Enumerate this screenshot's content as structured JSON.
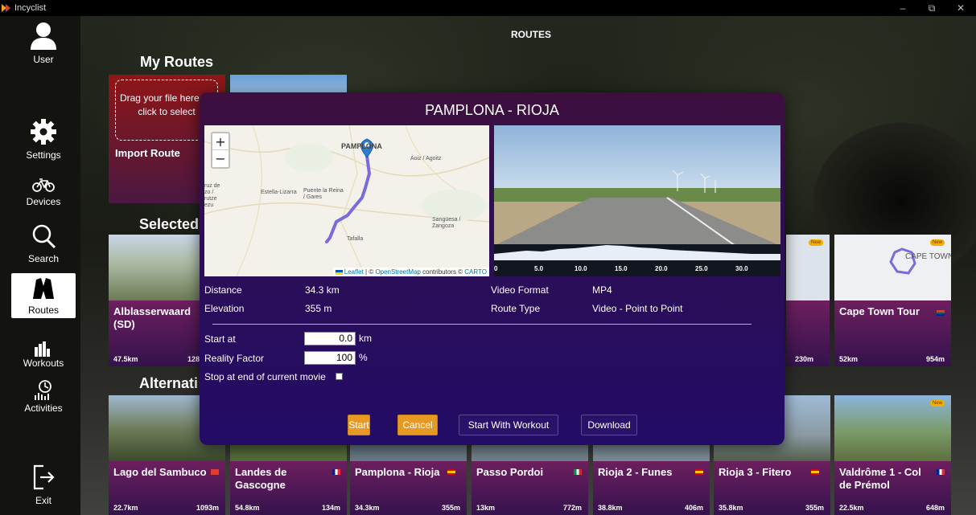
{
  "window": {
    "title": "Incyclist",
    "minimize": "–",
    "maximize": "⧉",
    "close": "✕"
  },
  "sidebar": [
    {
      "label": "User",
      "icon": "user-icon"
    },
    {
      "label": "Settings",
      "icon": "gear-icon"
    },
    {
      "label": "Devices",
      "icon": "bicycle-icon"
    },
    {
      "label": "Search",
      "icon": "search-icon"
    },
    {
      "label": "Routes",
      "icon": "routes-icon"
    },
    {
      "label": "Workouts",
      "icon": "workouts-icon"
    },
    {
      "label": "Activities",
      "icon": "activities-icon"
    },
    {
      "label": "Exit",
      "icon": "exit-icon"
    }
  ],
  "header": {
    "title": "ROUTES"
  },
  "sections": {
    "my_routes": "My Routes",
    "selected": "Selected",
    "alternatives": "Alternati"
  },
  "import": {
    "drop_text": "Drag your file here, or click to select",
    "label": "Import Route"
  },
  "selected_cards": [
    {
      "title": "Alblasserwaard (SD)",
      "distance": "47.5km",
      "elevation": "128"
    },
    {
      "title": "Cape Town Tour",
      "distance": "52km",
      "elevation": "954m",
      "badge": "New",
      "map_label": "CAPE TOWN"
    }
  ],
  "selected_partial": {
    "elevation": "230m",
    "badge": "New"
  },
  "alt_cards": [
    {
      "title": "Lago del Sambuco",
      "distance": "22.7km",
      "elevation": "1093m",
      "flag": "ch"
    },
    {
      "title": "Landes de Gascogne",
      "distance": "54.8km",
      "elevation": "134m",
      "flag": "fr"
    },
    {
      "title": "Pamplona - Rioja",
      "distance": "34.3km",
      "elevation": "355m",
      "flag": "es"
    },
    {
      "title": "Passo Pordoi",
      "distance": "13km",
      "elevation": "772m",
      "flag": "it"
    },
    {
      "title": "Rioja 2 - Funes",
      "distance": "38.8km",
      "elevation": "406m",
      "flag": "es"
    },
    {
      "title": "Rioja 3 - Fitero",
      "distance": "35.8km",
      "elevation": "355m",
      "flag": "es"
    },
    {
      "title": "Valdrôme 1 - Col de Prémol",
      "distance": "22.5km",
      "elevation": "648m",
      "flag": "fr",
      "badge": "New"
    }
  ],
  "modal": {
    "title": "PAMPLONA - RIOJA",
    "map": {
      "zoom_in": "+",
      "zoom_out": "−",
      "attribution_leaflet": "Leaflet",
      "attribution_sep": " | © ",
      "attribution_osm": "OpenStreetMap",
      "attribution_mid": " contributors © ",
      "attribution_carto": "CARTO",
      "places": {
        "pamplona": "PAMPLONA",
        "aoiz": "Aoiz / Agoitz",
        "estella": "Estella-Lizarra",
        "puente": "Puente la Reina / Gares",
        "sanguesa": "Sangüesa / Zangoza",
        "tafalla": "Tafalla",
        "left": "ruz de zo / rutze ezu"
      }
    },
    "profile_ticks": [
      "0",
      "5.0",
      "10.0",
      "15.0",
      "20.0",
      "25.0",
      "30.0"
    ],
    "info": {
      "distance_label": "Distance",
      "distance_value": "34.3 km",
      "elevation_label": "Elevation",
      "elevation_value": "355 m",
      "format_label": "Video Format",
      "format_value": "MP4",
      "type_label": "Route Type",
      "type_value": "Video - Point to Point"
    },
    "form": {
      "start_label": "Start at",
      "start_value": "0.0",
      "start_unit": "km",
      "reality_label": "Reality Factor",
      "reality_value": "100",
      "reality_unit": "%",
      "stop_label": "Stop at end of current movie",
      "stop_checked": false
    },
    "buttons": {
      "start": "Start",
      "cancel": "Cancel",
      "start_workout": "Start With Workout",
      "download": "Download"
    }
  },
  "colors": {
    "accent": "#e69a24",
    "card_gradient_top": "#6d1f5e",
    "card_gradient_bottom": "#34124d",
    "modal_bg": "#2d0e55",
    "route_line": "#7a6bdc"
  }
}
